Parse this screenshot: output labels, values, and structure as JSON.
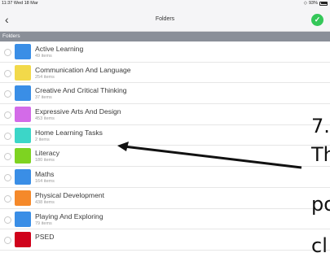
{
  "status": {
    "time": "11:37  Wed 18 Mar",
    "battery": "93%"
  },
  "nav": {
    "title": "Folders"
  },
  "section": {
    "title": "Folders"
  },
  "folders": [
    {
      "name": "Active Learning",
      "count": "49 items",
      "color": "#3a8ee6"
    },
    {
      "name": "Communication And Language",
      "count": "254 items",
      "color": "#f2d94a"
    },
    {
      "name": "Creative And Critical Thinking",
      "count": "37 items",
      "color": "#3a8ee6"
    },
    {
      "name": "Expressive Arts And Design",
      "count": "453 items",
      "color": "#d36be8"
    },
    {
      "name": "Home Learning Tasks",
      "count": "2 items",
      "color": "#3cd6c8"
    },
    {
      "name": "Literacy",
      "count": "180 items",
      "color": "#7ed321"
    },
    {
      "name": "Maths",
      "count": "164 items",
      "color": "#3a8ee6"
    },
    {
      "name": "Physical Development",
      "count": "438 items",
      "color": "#f5892a"
    },
    {
      "name": "Playing And Exploring",
      "count": "79 items",
      "color": "#3a8ee6"
    },
    {
      "name": "PSED",
      "count": "",
      "color": "#d0021b"
    }
  ],
  "overlay": {
    "line1": "7.",
    "line2": "Th",
    "line3": "po",
    "line4": "cl"
  }
}
